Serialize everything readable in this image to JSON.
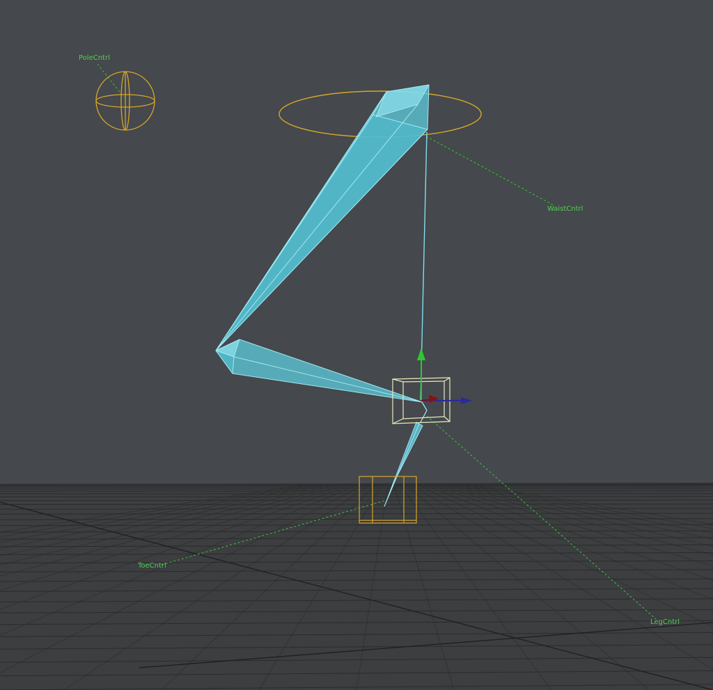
{
  "viewport": {
    "background_color": "#45484c",
    "floor_color": "#3c3e40",
    "grid_color": "#2a2b2c"
  },
  "colors": {
    "bone_fill": "#5ecbdc",
    "bone_edge": "#9fe8f2",
    "control_yellow": "#d9a62a",
    "control_pale": "#ecebbf",
    "label_green": "#4fd24f",
    "axis_y": "#2ec82e",
    "axis_x": "#2a2aa0",
    "axis_z": "#8a1010"
  },
  "controls": {
    "pole": {
      "label": "PoleCntrl",
      "icon": "sphere-icon"
    },
    "waist": {
      "label": "WaistCntrl",
      "icon": "ring-icon"
    },
    "leg": {
      "label": "LegCntrl",
      "icon": "cube-icon"
    },
    "toe": {
      "label": "ToeCntrl",
      "icon": "box-icon"
    }
  },
  "bones": [
    "upper-leg-bone",
    "lower-leg-bone",
    "foot-bone",
    "ik-chain-line"
  ],
  "gizmo": {
    "icon": "move-gizmo-icon"
  }
}
